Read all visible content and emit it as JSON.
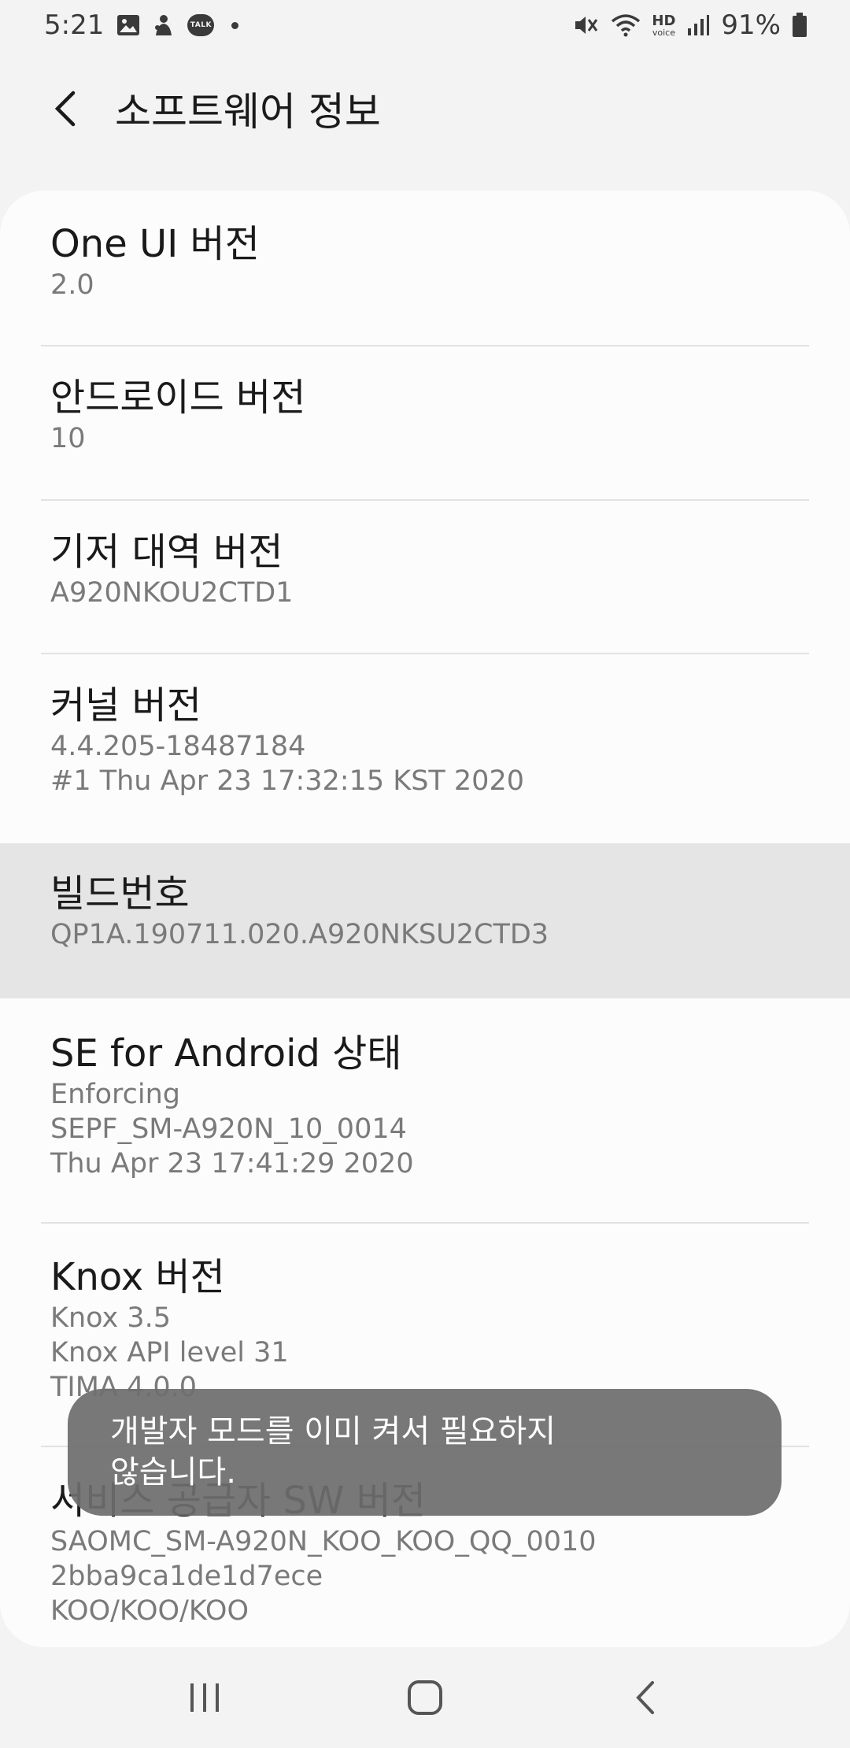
{
  "status_bar": {
    "time": "5:21",
    "talk_label": "TALK",
    "hd_label": "HD",
    "voice_label": "voice",
    "battery_percent": "91%"
  },
  "app_bar": {
    "title": "소프트웨어 정보"
  },
  "rows": [
    {
      "title": "One UI 버전",
      "lines": [
        "2.0"
      ]
    },
    {
      "title": "안드로이드 버전",
      "lines": [
        "10"
      ]
    },
    {
      "title": "기저 대역 버전",
      "lines": [
        "A920NKOU2CTD1"
      ]
    },
    {
      "title": "커널 버전",
      "lines": [
        "4.4.205-18487184",
        "#1 Thu Apr 23 17:32:15 KST 2020"
      ]
    },
    {
      "title": "빌드번호",
      "lines": [
        "QP1A.190711.020.A920NKSU2CTD3"
      ]
    },
    {
      "title": "SE for Android 상태",
      "lines": [
        "Enforcing",
        "SEPF_SM-A920N_10_0014",
        "Thu Apr 23 17:41:29 2020"
      ]
    },
    {
      "title": "Knox 버전",
      "lines": [
        "Knox 3.5",
        "Knox API level 31",
        "TIMA 4.0.0"
      ]
    },
    {
      "title": "서비스 공급자 SW 버전",
      "lines": [
        "SAOMC_SM-A920N_KOO_KOO_QQ_0010",
        "2bba9ca1de1d7ece",
        "KOO/KOO/KOO"
      ]
    }
  ],
  "toast": {
    "line1": "개발자 모드를 이미 켜서 필요하지",
    "line2": "않습니다."
  },
  "colors": {
    "background": "#f3f3f3",
    "card": "#fcfcfc",
    "highlight": "#e5e5e5",
    "toast": "#6e6e6e"
  }
}
